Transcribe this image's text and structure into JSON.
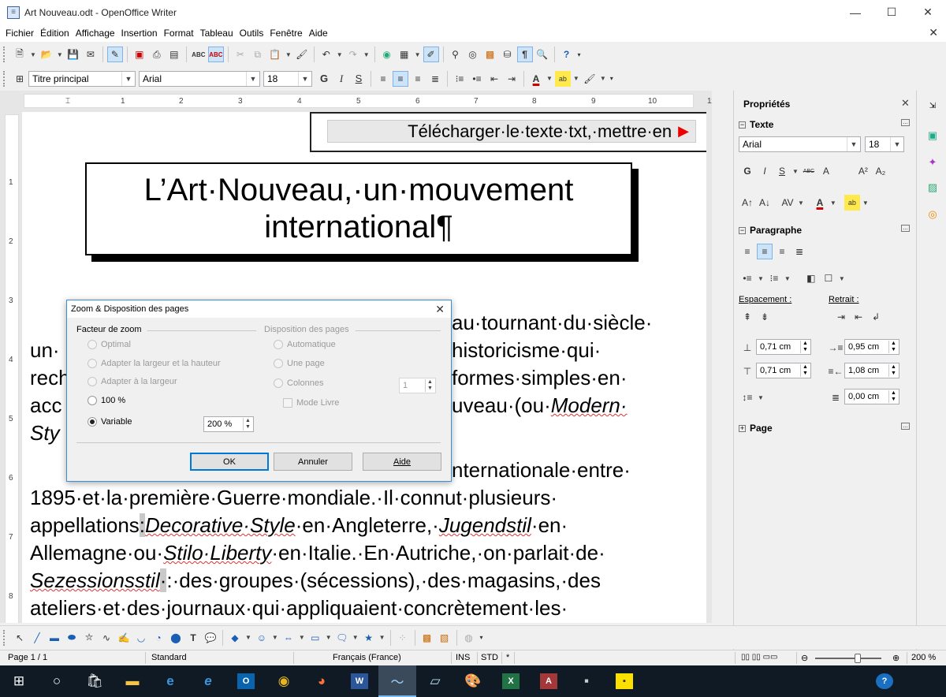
{
  "window": {
    "title": "Art Nouveau.odt - OpenOffice Writer",
    "min": "—",
    "max": "☐",
    "close": "✕",
    "doc_close": "✕"
  },
  "menu": [
    {
      "u": "F",
      "rest": "ichier"
    },
    {
      "u": "É",
      "rest": "dition"
    },
    {
      "u": "A",
      "rest": "ffichage"
    },
    {
      "u": "I",
      "rest": "nsertion"
    },
    {
      "u": "",
      "rest": "Format",
      "alt": true
    },
    {
      "u": "",
      "rest": "Tableau",
      "alt2": true
    },
    {
      "u": "O",
      "rest": "utils"
    },
    {
      "u": "",
      "rest": "Fenêtre",
      "alt3": true
    },
    {
      "u": "",
      "rest": "Aide",
      "alt4": true
    }
  ],
  "menu_labels": [
    "Fichier",
    "Édition",
    "Affichage",
    "Insertion",
    "Format",
    "Tableau",
    "Outils",
    "Fenêtre",
    "Aide"
  ],
  "formatting": {
    "style": "Titre principal",
    "font": "Arial",
    "size": "18",
    "bold": "G",
    "italic": "I",
    "underline": "S"
  },
  "ruler": {
    "h": [
      "1",
      "2",
      "3",
      "4",
      "5",
      "6",
      "7",
      "8",
      "9",
      "10",
      "11"
    ],
    "v": [
      "1",
      "2",
      "3",
      "4",
      "5",
      "6",
      "7",
      "8"
    ]
  },
  "document": {
    "banner": "Télécharger·le·texte·txt,·mettre·en",
    "banner_icon": "▶",
    "title_line1": "L’Art·Nouveau,·un·mouvement",
    "title_line2": "international¶",
    "lines": [
      "au·tournant·du·siècle·",
      "un·",
      "historicisme·qui·",
      "rech",
      "formes·simples·en·",
      "acc",
      "uveau·(ou·",
      "Modern·",
      "Sty",
      "nternationale·entre·",
      "1895·et·la·première·Guerre·mondiale.·Il·connut·plusieurs·",
      "appellations",
      ":",
      "·:·",
      "Decorative·Style",
      "·en·Angleterre,·",
      "Jugendstil",
      "·en·",
      "Allemagne·ou·",
      "Stilo·Liberty",
      "·en·Italie.·En·Autriche,·on·parlait·de·",
      "Sezessionsstil",
      "·",
      ":·des·groupes·(sécessions),·des·magasins,·des",
      "ateliers·et·des·journaux·qui·appliquaient·concrètement·les·"
    ]
  },
  "dialog": {
    "title": "Zoom & Disposition des pages",
    "close": "✕",
    "zoom_group": "Facteur de zoom",
    "layout_group": "Disposition des pages",
    "zoom_options": [
      "Optimal",
      "Adapter la largeur et la hauteur",
      "Adapter à la largeur",
      "100 %",
      "Variable"
    ],
    "variable_value": "200 %",
    "layout_options": [
      "Automatique",
      "Une page",
      "Colonnes"
    ],
    "columns_value": "1",
    "book_mode": "Mode Livre",
    "buttons": {
      "ok": "OK",
      "cancel": "Annuler",
      "help": "Aide"
    }
  },
  "sidebar": {
    "title": "Propriétés",
    "close": "✕",
    "text_section": "Texte",
    "font": "Arial",
    "size": "18",
    "para_section": "Paragraphe",
    "spacing_label": "Espacement :",
    "indent_label": "Retrait :",
    "spacing_above": "0,71 cm",
    "spacing_below": "0,71 cm",
    "indent_before": "0,95 cm",
    "indent_after": "1,08 cm",
    "indent_first": "0,00 cm",
    "page_section": "Page"
  },
  "status": {
    "page": "Page 1 / 1",
    "style": "Standard",
    "language": "Français (France)",
    "ins": "INS",
    "std": "STD",
    "mod": "*",
    "zoom": "200 %"
  },
  "taskbar": [
    "windows-start",
    "cortana",
    "store",
    "explorer",
    "edge",
    "ie",
    "outlook",
    "chrome",
    "firefox",
    "word",
    "openoffice-writer",
    "notepad",
    "paint",
    "excel",
    "access",
    "misc",
    "sticky-notes",
    "help"
  ]
}
